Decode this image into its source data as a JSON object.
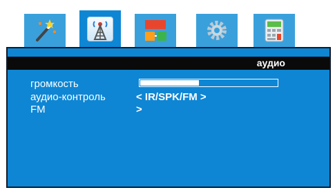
{
  "tabs": [
    {
      "icon": "magic-wand-icon",
      "active": false
    },
    {
      "icon": "antenna-icon",
      "active": true
    },
    {
      "icon": "blocks-icon",
      "active": false
    },
    {
      "icon": "gear-icon",
      "active": false
    },
    {
      "icon": "calculator-icon",
      "active": false
    }
  ],
  "menu": {
    "title": "аудио",
    "volume": {
      "label": "громкость",
      "level": 0.43
    },
    "audio_control": {
      "label": "аудио-контроль",
      "value": "< IR/SPK/FM >"
    },
    "fm": {
      "label": "FM",
      "value": ">"
    }
  },
  "colors": {
    "panel": "#0e86d4",
    "tab": "#3aa0dc",
    "title_strip": "#0a0a0a",
    "text": "#ffffff"
  }
}
